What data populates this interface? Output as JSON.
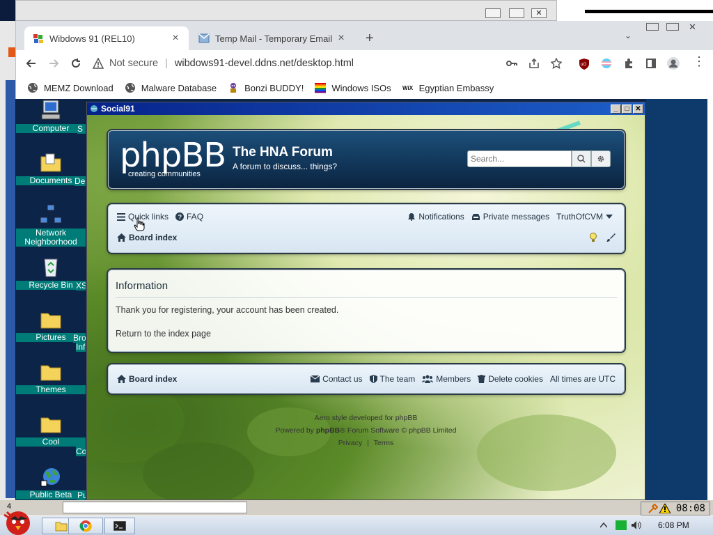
{
  "outer_window": {
    "minimize": "▭",
    "maximize": "❐",
    "close": "✕"
  },
  "browser": {
    "tabs": [
      {
        "title": "Wibdows 91 (REL10)",
        "active": true
      },
      {
        "title": "Temp Mail - Temporary Email",
        "active": false
      }
    ],
    "new_tab": "+",
    "security": "Not secure",
    "url": "wibdows91-devel.ddns.net/desktop.html",
    "bookmarks": [
      {
        "label": "MEMZ Download",
        "icon": "globe-icon"
      },
      {
        "label": "Malware Database",
        "icon": "globe-icon"
      },
      {
        "label": "Bonzi BUDDY!",
        "icon": "bonzi-icon"
      },
      {
        "label": "Windows ISOs",
        "icon": "rainbow-flag-icon"
      },
      {
        "label": "Egyptian Embassy",
        "icon": "wix-icon"
      }
    ]
  },
  "desktop": {
    "icons": [
      {
        "label": "Computer",
        "icon": "computer-icon"
      },
      {
        "label": "Documents",
        "icon": "documents-folder-icon"
      },
      {
        "label": "Network Neighborhood",
        "icon": "network-icon"
      },
      {
        "label": "Recycle Bin",
        "icon": "recycle-bin-icon"
      },
      {
        "label": "Pictures",
        "icon": "folder-icon"
      },
      {
        "label": "Themes",
        "icon": "folder-icon"
      },
      {
        "label": "Cool",
        "icon": "folder-icon"
      },
      {
        "label": "Public Beta",
        "icon": "globe-icon"
      }
    ],
    "partial_labels": [
      "S",
      "De",
      "XS",
      "Bro",
      "Inf",
      "Co",
      "Pu"
    ]
  },
  "window": {
    "title": "Social91"
  },
  "forum": {
    "logo": "phpBB",
    "logo_tagline": "creating communities",
    "site_title": "The HNA Forum",
    "site_description": "A forum to discuss... things?",
    "search_placeholder": "Search...",
    "nav": {
      "quick_links": "Quick links",
      "faq": "FAQ",
      "notifications": "Notifications",
      "private_messages": "Private messages",
      "user": "TruthOfCVM",
      "board_index": "Board index"
    },
    "info": {
      "heading": "Information",
      "message": "Thank you for registering, your account has been created.",
      "return_link": "Return to the index page"
    },
    "footer_nav": {
      "board_index": "Board index",
      "contact": "Contact us",
      "team": "The team",
      "members": "Members",
      "delete_cookies": "Delete cookies",
      "timezone": "All times are UTC"
    },
    "copyright": {
      "line1": "Aero style developed for phpBB",
      "powered_prefix": "Powered by ",
      "powered_brand": "phpBB",
      "powered_suffix": "® Forum Software © phpBB Limited",
      "privacy": "Privacy",
      "separator": "|",
      "terms": "Terms"
    }
  },
  "taskbar": {
    "old_clock": "08:08",
    "scroll_number": "4",
    "clock": "6:08 PM"
  }
}
